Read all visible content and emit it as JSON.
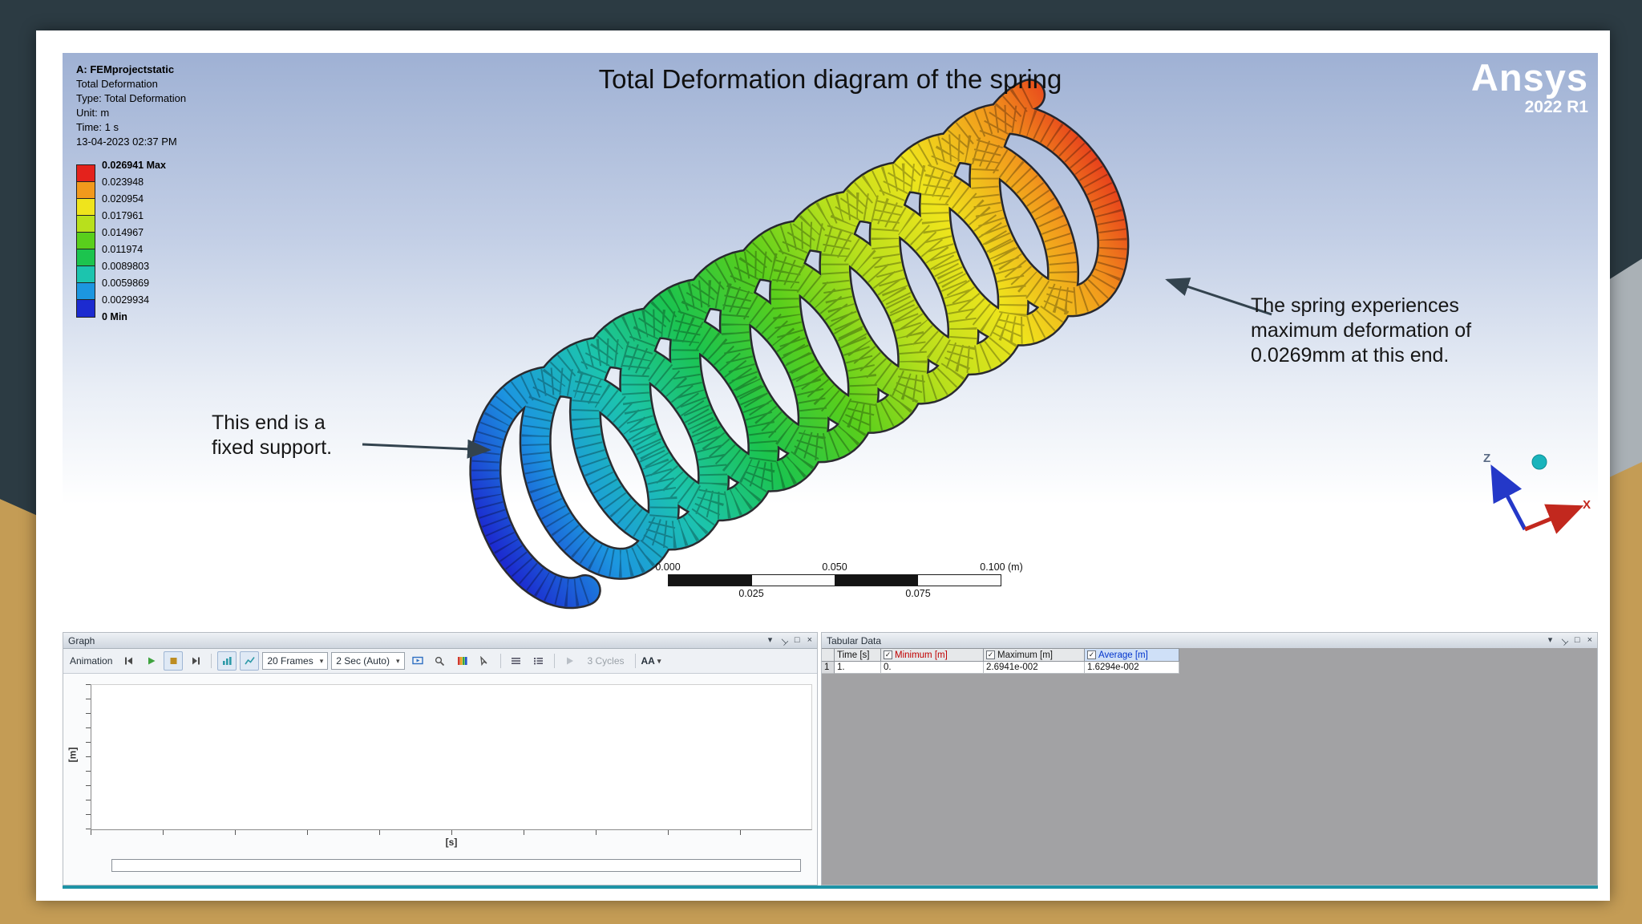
{
  "slide": {
    "title": "Total Deformation diagram of the spring",
    "brand": {
      "name": "Ansys",
      "release": "2022 R1"
    }
  },
  "viewport": {
    "info_lines": [
      "A: FEMprojectstatic",
      "Total Deformation",
      "Type: Total Deformation",
      "Unit: m",
      "Time: 1 s",
      "13-04-2023 02:37 PM"
    ],
    "legend": {
      "labels": [
        "0.026941 Max",
        "0.023948",
        "0.020954",
        "0.017961",
        "0.014967",
        "0.011974",
        "0.0089803",
        "0.0059869",
        "0.0029934",
        "0 Min"
      ],
      "colors": [
        "#e4221c",
        "#f2991c",
        "#efe41c",
        "#b8e01c",
        "#59cf1c",
        "#1cc44e",
        "#1cc4ae",
        "#1c96e0",
        "#1c2bd0"
      ]
    },
    "annotations": {
      "fixed_end": "This end is a fixed support.",
      "max_end": "The spring experiences maximum deformation of 0.0269mm  at this end."
    },
    "scale_bar": {
      "labels_top": [
        "0.000",
        "0.050",
        "0.100 (m)"
      ],
      "labels_bottom": [
        "0.025",
        "0.075"
      ]
    },
    "triad": {
      "z": "Z",
      "x": "X"
    }
  },
  "graph": {
    "title": "Graph",
    "toolbar": {
      "animation": "Animation",
      "frames": "20 Frames",
      "duration": "2 Sec (Auto)",
      "cycles": "3 Cycles",
      "aa": "AA"
    },
    "axes": {
      "y": "[m]",
      "x": "[s]"
    }
  },
  "tabular": {
    "title": "Tabular Data",
    "columns": [
      {
        "label": "Time [s]"
      },
      {
        "label": "Minimum [m]"
      },
      {
        "label": "Maximum [m]"
      },
      {
        "label": "Average [m]"
      }
    ],
    "rows": [
      {
        "index": "1",
        "time": "1.",
        "min": "0.",
        "max": "2.6941e-002",
        "avg": "1.6294e-002"
      }
    ]
  }
}
